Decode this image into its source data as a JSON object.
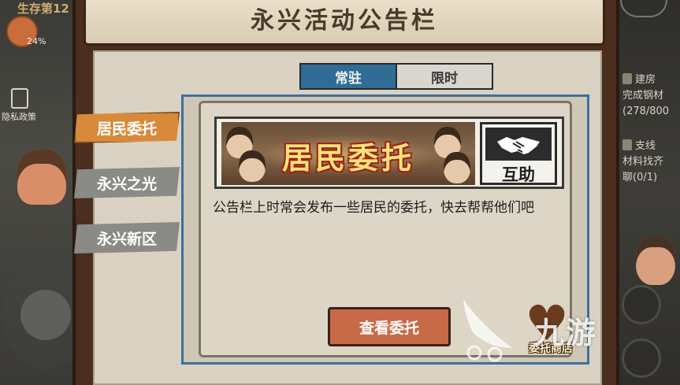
{
  "hud": {
    "survival_label": "生存第12",
    "percent": "24%",
    "privacy_label": "隐私政策"
  },
  "header": {
    "title": "永兴活动公告栏"
  },
  "tabs": [
    {
      "label": "常驻",
      "active": true
    },
    {
      "label": "限时",
      "active": false
    }
  ],
  "side_tabs": [
    {
      "label": "居民委托",
      "active": true
    },
    {
      "label": "永兴之光",
      "active": false
    },
    {
      "label": "永兴新区",
      "active": false
    }
  ],
  "banner": {
    "title": "居民委托",
    "badge_label": "互助",
    "badge_icon": "handshake-icon"
  },
  "description": "公告栏上时常会发布一些居民的委托，快去帮帮他们吧",
  "view_button_label": "查看委托",
  "shop_label": "委托商店",
  "watermark": "九游",
  "tasks": [
    {
      "line1": "建房",
      "line2": "完成钢材",
      "line3": "(278/800"
    },
    {
      "line1": "支线",
      "line2": "材料找齐",
      "line3": "聊(0/1)"
    }
  ],
  "colors": {
    "tab_active": "#2f6d95",
    "side_tab_active": "#d88a3a",
    "side_tab_inactive": "#8a8a86",
    "button": "#c76a48",
    "content_border": "#3e6f9a"
  }
}
